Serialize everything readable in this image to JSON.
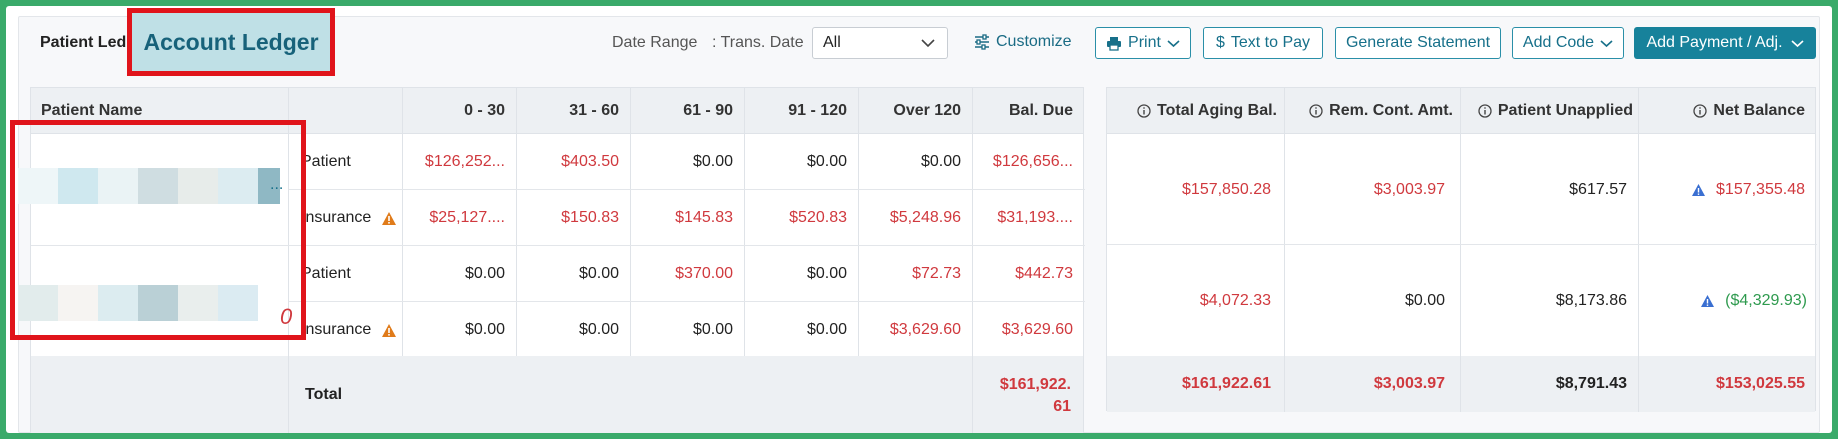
{
  "tabs": {
    "patient_ledger": "Patient Led",
    "account_ledger": "Account Ledger"
  },
  "filters": {
    "date_range_label": "Date Range",
    "trans_date_label": ": Trans. Date",
    "trans_date_value": "All"
  },
  "toolbar": {
    "customize": "Customize",
    "print": "Print",
    "text_to_pay": "Text to Pay",
    "generate_statement": "Generate Statement",
    "add_code": "Add Code",
    "add_payment": "Add Payment / Adj."
  },
  "aging_table": {
    "headers": {
      "patient_name": "Patient Name",
      "c0_30": "0 - 30",
      "c31_60": "31 - 60",
      "c61_90": "61 - 90",
      "c91_120": "91 - 120",
      "over_120": "Over 120",
      "bal_due": "Bal. Due"
    },
    "rows": [
      {
        "type": "Patient",
        "c0_30": "$126,252...",
        "c31_60": "$403.50",
        "c61_90": "$0.00",
        "c91_120": "$0.00",
        "over_120": "$0.00",
        "bal_due": "$126,656..."
      },
      {
        "type": "Insurance",
        "c0_30": "$25,127....",
        "c31_60": "$150.83",
        "c61_90": "$145.83",
        "c91_120": "$520.83",
        "over_120": "$5,248.96",
        "bal_due": "$31,193...."
      },
      {
        "type": "Patient",
        "c0_30": "$0.00",
        "c31_60": "$0.00",
        "c61_90": "$370.00",
        "c91_120": "$0.00",
        "over_120": "$72.73",
        "bal_due": "$442.73"
      },
      {
        "type": "Insurance",
        "c0_30": "$0.00",
        "c31_60": "$0.00",
        "c61_90": "$0.00",
        "c91_120": "$0.00",
        "over_120": "$3,629.60",
        "bal_due": "$3,629.60"
      }
    ],
    "total_label": "Total",
    "total_bal_due_line1": "$161,922.",
    "total_bal_due_line2": "61",
    "name_fragment_1": "...",
    "name_fragment_2": "0"
  },
  "balance_table": {
    "headers": {
      "total_aging": "Total Aging Bal.",
      "rem_cont": "Rem. Cont. Amt.",
      "patient_unapplied": "Patient Unapplied",
      "net_balance": "Net Balance"
    },
    "rows": [
      {
        "total_aging": "$157,850.28",
        "rem_cont": "$3,003.97",
        "patient_unapplied": "$617.57",
        "net_balance": "$157,355.48"
      },
      {
        "total_aging": "$4,072.33",
        "rem_cont": "$0.00",
        "patient_unapplied": "$8,173.86",
        "net_balance": "($4,329.93)"
      }
    ],
    "totals": {
      "total_aging": "$161,922.61",
      "rem_cont": "$3,003.97",
      "patient_unapplied": "$8,791.43",
      "net_balance": "$153,025.55"
    }
  },
  "colors": {
    "brand": "#17829b",
    "negative_red": "#d0393e",
    "credit_green": "#2e9a4e",
    "warning_orange": "#e07b1a",
    "info_blue": "#3a6fd1",
    "highlight_red": "#e0141b"
  }
}
